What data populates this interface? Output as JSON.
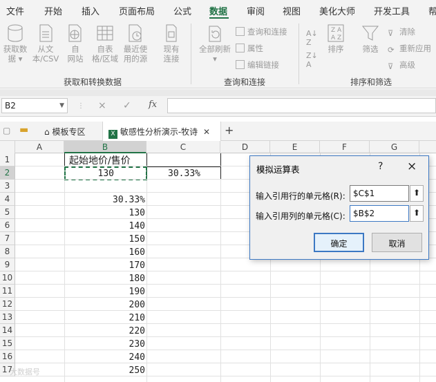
{
  "ribbon_tabs": [
    "文件",
    "开始",
    "插入",
    "页面布局",
    "公式",
    "数据",
    "审阅",
    "视图",
    "美化大师",
    "开发工具",
    "帮"
  ],
  "active_tab": "数据",
  "ribbon": {
    "get_data": {
      "line1": "获取数",
      "line2": "据"
    },
    "from_text": {
      "line1": "从文",
      "line2": "本/CSV"
    },
    "from_web": {
      "line1": "自",
      "line2": "网站"
    },
    "from_table": {
      "line1": "自表",
      "line2": "格/区域"
    },
    "recent_sources": {
      "line1": "最近使",
      "line2": "用的源"
    },
    "existing_conn": {
      "line1": "现有",
      "line2": "连接"
    },
    "refresh_all": {
      "line1": "全部刷新"
    },
    "queries_conn": "查询和连接",
    "properties": "属性",
    "edit_links": "编辑链接",
    "sort": "排序",
    "filter": "筛选",
    "clear": "清除",
    "reapply": "重新应用",
    "advanced": "高级",
    "group_get": "获取和转换数据",
    "group_query": "查询和连接",
    "group_sort": "排序和筛选"
  },
  "formula_bar": {
    "name_box": "B2",
    "cancel": "×",
    "enter": "✓",
    "fx": "fx",
    "formula": ""
  },
  "doc_tabs": {
    "template": "模板专区",
    "file": "敏感性分析演示-牧诗",
    "add": "+"
  },
  "columns": [
    "A",
    "B",
    "C",
    "D",
    "E",
    "F",
    "G"
  ],
  "rows": [
    "1",
    "2",
    "3",
    "4",
    "5",
    "6",
    "7",
    "8",
    "9",
    "10",
    "11",
    "12",
    "13",
    "14",
    "15",
    "16",
    "17"
  ],
  "cells": {
    "B1": "起始地价/售价",
    "B2": "130",
    "C2": "30.33%",
    "B4": "30.33%",
    "B5": "130",
    "B6": "140",
    "B7": "150",
    "B8": "160",
    "B9": "170",
    "B10": "180",
    "B11": "190",
    "B12": "200",
    "B13": "210",
    "B14": "220",
    "B15": "230",
    "B16": "240",
    "B17": "250"
  },
  "dialog": {
    "title": "模拟运算表",
    "help": "?",
    "close": "×",
    "row_label": "输入引用行的单元格(R):",
    "row_value": "$C$1",
    "col_label": "输入引用列的单元格(C):",
    "col_value": "$B$2",
    "ok": "确定",
    "cancel": "取消"
  },
  "watermark": "大数据号",
  "colors": {
    "accent": "#217346",
    "dialog_border": "#3c78c3"
  }
}
